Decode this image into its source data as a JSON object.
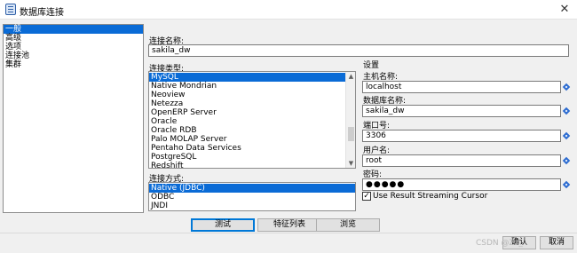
{
  "window": {
    "title": "数据库连接",
    "icon": "database-icon",
    "close_glyph": "✕"
  },
  "nav": {
    "items": [
      {
        "label": "一般",
        "selected": true
      },
      {
        "label": "高级",
        "selected": false
      },
      {
        "label": "选项",
        "selected": false
      },
      {
        "label": "连接池",
        "selected": false
      },
      {
        "label": "集群",
        "selected": false
      }
    ]
  },
  "connection_name": {
    "label": "连接名称:",
    "value": "sakila_dw"
  },
  "connection_type": {
    "label": "连接类型:",
    "items": [
      {
        "label": "MySQL",
        "selected": true
      },
      {
        "label": "Native Mondrian",
        "selected": false
      },
      {
        "label": "Neoview",
        "selected": false
      },
      {
        "label": "Netezza",
        "selected": false
      },
      {
        "label": "OpenERP Server",
        "selected": false
      },
      {
        "label": "Oracle",
        "selected": false
      },
      {
        "label": "Oracle RDB",
        "selected": false
      },
      {
        "label": "Palo MOLAP Server",
        "selected": false
      },
      {
        "label": "Pentaho Data Services",
        "selected": false
      },
      {
        "label": "PostgreSQL",
        "selected": false
      },
      {
        "label": "Redshift",
        "selected": false
      }
    ]
  },
  "access_method": {
    "label": "连接方式:",
    "items": [
      {
        "label": "Native (JDBC)",
        "selected": true
      },
      {
        "label": "ODBC",
        "selected": false
      },
      {
        "label": "JNDI",
        "selected": false
      }
    ]
  },
  "settings": {
    "heading": "设置",
    "host_label": "主机名称:",
    "host_value": "localhost",
    "db_label": "数据库名称:",
    "db_value": "sakila_dw",
    "port_label": "端口号:",
    "port_value": "3306",
    "user_label": "用户名:",
    "user_value": "root",
    "password_label": "密码:",
    "password_value": "●●●●●",
    "streaming_label": "Use Result Streaming Cursor",
    "streaming_checked": true
  },
  "buttons": {
    "test": "测试",
    "features": "特征列表",
    "browse": "浏览",
    "ok": "确认",
    "cancel": "取消"
  },
  "watermark": "CSDN @Zz_"
}
